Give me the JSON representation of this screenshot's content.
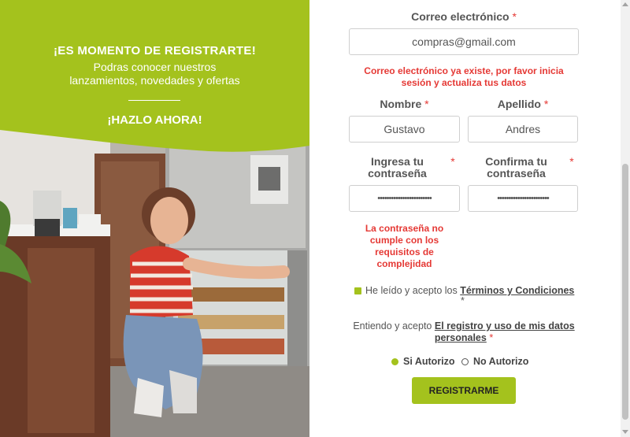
{
  "promo": {
    "headline": "¡ES MOMENTO DE REGISTRARTE!",
    "subtitle_line1": "Podras conocer nuestros",
    "subtitle_line2": "lanzamientos, novedades y ofertas",
    "cta": "¡HAZLO AHORA!"
  },
  "form": {
    "email": {
      "label": "Correo electrónico",
      "required": "*",
      "value": "compras@gmail.com",
      "error_line1": "Correo electrónico ya existe, por favor inicia",
      "error_line2": "sesión y actualiza tus datos"
    },
    "name": {
      "label": "Nombre",
      "required": "*",
      "value": "Gustavo"
    },
    "lastname": {
      "label": "Apellido",
      "required": "*",
      "value": "Andres"
    },
    "password": {
      "label_line1": "Ingresa tu",
      "label_line2": "contraseña",
      "required": "*",
      "value": "••••••••••••••••••••••••",
      "error_line1": "La contraseña no",
      "error_line2": "cumple con los",
      "error_line3": "requisitos de",
      "error_line4": "complejidad"
    },
    "confirm": {
      "label_line1": "Confirma tu",
      "label_line2": "contraseña",
      "required": "*",
      "value": "•••••••••••••••••••••••"
    },
    "terms": {
      "text": "He leído y acepto los ",
      "link": "Términos y Condiciones",
      "required": "*"
    },
    "consent": {
      "text": "Entiendo y acepto ",
      "link_line1": "El registro y uso de mis datos",
      "link_line2": "personales",
      "required": "*"
    },
    "radio_yes": "Si Autorizo",
    "radio_no": "No Autorizo",
    "submit": "REGISTRARME"
  },
  "colors": {
    "brand_green": "#a4c21d",
    "error_red": "#e53935",
    "text_gray": "#555555"
  },
  "icons": {
    "checkbox": "checkbox-checked-icon",
    "radio_selected": "radio-selected-icon",
    "radio_unselected": "radio-unselected-icon"
  }
}
